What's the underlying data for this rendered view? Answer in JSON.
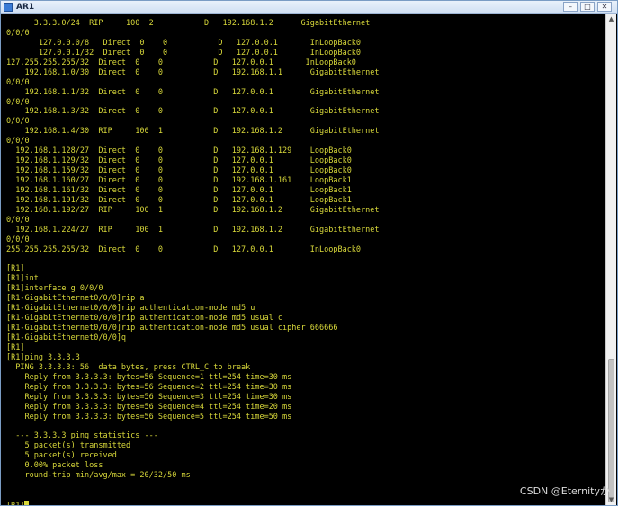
{
  "window": {
    "title": "AR1",
    "controls": {
      "minimize": "–",
      "maximize": "□",
      "close": "✕"
    }
  },
  "terminal": {
    "lines": [
      "      3.3.3.0/24  RIP     100  2           D   192.168.1.2      GigabitEthernet",
      "0/0/0",
      "       127.0.0.0/8   Direct  0    0           D   127.0.0.1       InLoopBack0",
      "       127.0.0.1/32  Direct  0    0           D   127.0.0.1       InLoopBack0",
      "127.255.255.255/32  Direct  0    0           D   127.0.0.1       InLoopBack0",
      "    192.168.1.0/30  Direct  0    0           D   192.168.1.1      GigabitEthernet",
      "0/0/0",
      "    192.168.1.1/32  Direct  0    0           D   127.0.0.1        GigabitEthernet",
      "0/0/0",
      "    192.168.1.3/32  Direct  0    0           D   127.0.0.1        GigabitEthernet",
      "0/0/0",
      "    192.168.1.4/30  RIP     100  1           D   192.168.1.2      GigabitEthernet",
      "0/0/0",
      "  192.168.1.128/27  Direct  0    0           D   192.168.1.129    LoopBack0",
      "  192.168.1.129/32  Direct  0    0           D   127.0.0.1        LoopBack0",
      "  192.168.1.159/32  Direct  0    0           D   127.0.0.1        LoopBack0",
      "  192.168.1.160/27  Direct  0    0           D   192.168.1.161    LoopBack1",
      "  192.168.1.161/32  Direct  0    0           D   127.0.0.1        LoopBack1",
      "  192.168.1.191/32  Direct  0    0           D   127.0.0.1        LoopBack1",
      "  192.168.1.192/27  RIP     100  1           D   192.168.1.2      GigabitEthernet",
      "0/0/0",
      "  192.168.1.224/27  RIP     100  1           D   192.168.1.2      GigabitEthernet",
      "0/0/0",
      "255.255.255.255/32  Direct  0    0           D   127.0.0.1        InLoopBack0",
      "",
      "[R1]",
      "[R1]int",
      "[R1]interface g 0/0/0",
      "[R1-GigabitEthernet0/0/0]rip a",
      "[R1-GigabitEthernet0/0/0]rip authentication-mode md5 u",
      "[R1-GigabitEthernet0/0/0]rip authentication-mode md5 usual c",
      "[R1-GigabitEthernet0/0/0]rip authentication-mode md5 usual cipher 666666",
      "[R1-GigabitEthernet0/0/0]q",
      "[R1]",
      "[R1]ping 3.3.3.3",
      "  PING 3.3.3.3: 56  data bytes, press CTRL_C to break",
      "    Reply from 3.3.3.3: bytes=56 Sequence=1 ttl=254 time=30 ms",
      "    Reply from 3.3.3.3: bytes=56 Sequence=2 ttl=254 time=30 ms",
      "    Reply from 3.3.3.3: bytes=56 Sequence=3 ttl=254 time=30 ms",
      "    Reply from 3.3.3.3: bytes=56 Sequence=4 ttl=254 time=20 ms",
      "    Reply from 3.3.3.3: bytes=56 Sequence=5 ttl=254 time=50 ms",
      "",
      "  --- 3.3.3.3 ping statistics ---",
      "    5 packet(s) transmitted",
      "    5 packet(s) received",
      "    0.00% packet loss",
      "    round-trip min/avg/max = 20/32/50 ms",
      "",
      ""
    ],
    "prompt": "[R1]"
  },
  "watermark": "CSDN @Eternityか",
  "colors": {
    "console_background": "#000000",
    "console_text": "#d8d83a"
  }
}
